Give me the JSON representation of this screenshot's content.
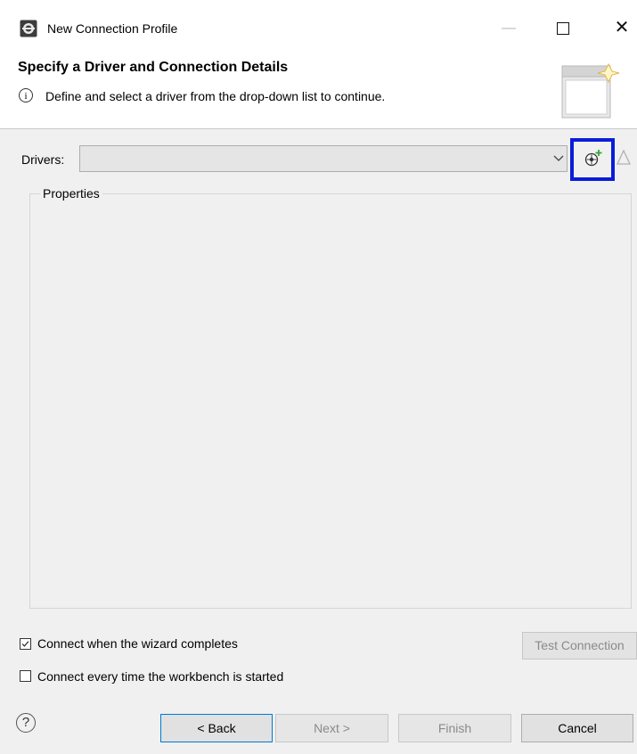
{
  "window": {
    "title": "New Connection Profile",
    "minimize_glyph": "—",
    "close_glyph": "✕"
  },
  "banner": {
    "title": "Specify a Driver and Connection Details",
    "info_glyph": "i",
    "description": "Define and select a driver from the drop-down list to continue."
  },
  "drivers": {
    "label": "Drivers:",
    "selected_value": ""
  },
  "properties": {
    "label": "Properties"
  },
  "options": {
    "connect_on_complete": {
      "label": "Connect when the wizard completes",
      "checked": true
    },
    "connect_on_startup": {
      "label": "Connect every time the workbench is started",
      "checked": false
    }
  },
  "buttons": {
    "test_connection": "Test Connection",
    "help": "?",
    "back": "< Back",
    "next": "Next >",
    "finish": "Finish",
    "cancel": "Cancel"
  },
  "colors": {
    "highlight_box": "#0a1dd8",
    "default_button_border": "#0078d7"
  }
}
